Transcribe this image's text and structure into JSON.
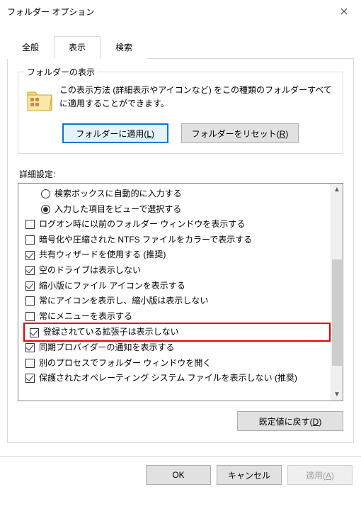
{
  "window": {
    "title": "フォルダー オプション"
  },
  "tabs": {
    "general": "全般",
    "view": "表示",
    "search": "検索"
  },
  "folderView": {
    "groupTitle": "フォルダーの表示",
    "desc": "この表示方法 (詳細表示やアイコンなど) をこの種類のフォルダーすべてに適用することができます。",
    "applyBtn": "フォルダーに適用(L)",
    "resetBtn": "フォルダーをリセット(R)"
  },
  "advanced": {
    "label": "詳細設定:",
    "items": [
      {
        "kind": "radio",
        "checked": false,
        "indent": true,
        "label": "検索ボックスに自動的に入力する"
      },
      {
        "kind": "radio",
        "checked": true,
        "indent": true,
        "label": "入力した項目をビューで選択する"
      },
      {
        "kind": "check",
        "checked": false,
        "label": "ログオン時に以前のフォルダー ウィンドウを表示する"
      },
      {
        "kind": "check",
        "checked": false,
        "label": "暗号化や圧縮された NTFS ファイルをカラーで表示する"
      },
      {
        "kind": "check",
        "checked": true,
        "label": "共有ウィザードを使用する (推奨)"
      },
      {
        "kind": "check",
        "checked": true,
        "label": "空のドライブは表示しない"
      },
      {
        "kind": "check",
        "checked": true,
        "label": "縮小版にファイル アイコンを表示する"
      },
      {
        "kind": "check",
        "checked": false,
        "label": "常にアイコンを表示し、縮小版は表示しない"
      },
      {
        "kind": "check",
        "checked": false,
        "label": "常にメニューを表示する"
      },
      {
        "kind": "check",
        "checked": true,
        "highlight": true,
        "label": "登録されている拡張子は表示しない"
      },
      {
        "kind": "check",
        "checked": true,
        "label": "同期プロバイダーの通知を表示する"
      },
      {
        "kind": "check",
        "checked": false,
        "label": "別のプロセスでフォルダー ウィンドウを開く"
      },
      {
        "kind": "check",
        "checked": true,
        "label": "保護されたオペレーティング システム ファイルを表示しない (推奨)"
      }
    ],
    "restoreBtn": "既定値に戻す(D)"
  },
  "footer": {
    "ok": "OK",
    "cancel": "キャンセル",
    "apply": "適用(A)"
  }
}
